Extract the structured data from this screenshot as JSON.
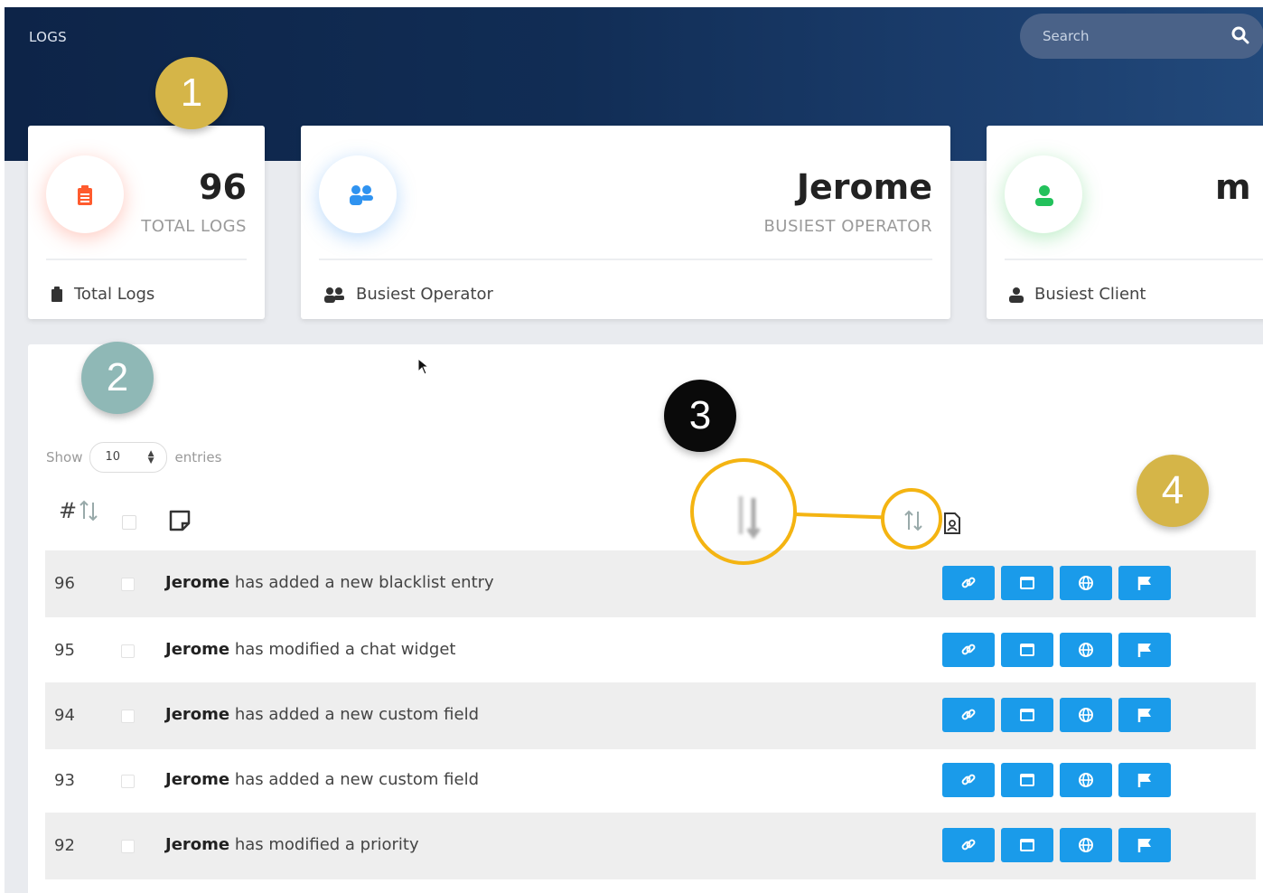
{
  "header": {
    "title": "LOGS",
    "search_placeholder": "Search"
  },
  "cards": [
    {
      "value": "96",
      "subtitle": "TOTAL LOGS",
      "footer": "Total Logs",
      "icon": "clipboard-icon",
      "accent": "#ff5b2e"
    },
    {
      "value": "Jerome",
      "subtitle": "BUSIEST OPERATOR",
      "footer": "Busiest Operator",
      "icon": "users-icon",
      "accent": "#2f93f0"
    },
    {
      "value": "m",
      "subtitle": "",
      "footer": "Busiest Client",
      "icon": "user-icon",
      "accent": "#22c15b"
    }
  ],
  "table": {
    "show_label": "Show",
    "entries_value": "10",
    "entries_label": "entries",
    "header_hash": "#",
    "rows": [
      {
        "id": "96",
        "user": "Jerome",
        "action": " has added a new blacklist entry"
      },
      {
        "id": "95",
        "user": "Jerome",
        "action": " has modified a chat widget"
      },
      {
        "id": "94",
        "user": "Jerome",
        "action": " has added a new custom field"
      },
      {
        "id": "93",
        "user": "Jerome",
        "action": " has added a new custom field"
      },
      {
        "id": "92",
        "user": "Jerome",
        "action": " has modified a priority"
      }
    ],
    "row_actions": [
      "link-icon",
      "window-icon",
      "globe-icon",
      "flag-icon"
    ],
    "action_color": "#1a9bea"
  },
  "callouts": [
    "1",
    "2",
    "3",
    "4"
  ],
  "annotation_color": "#f4b412"
}
